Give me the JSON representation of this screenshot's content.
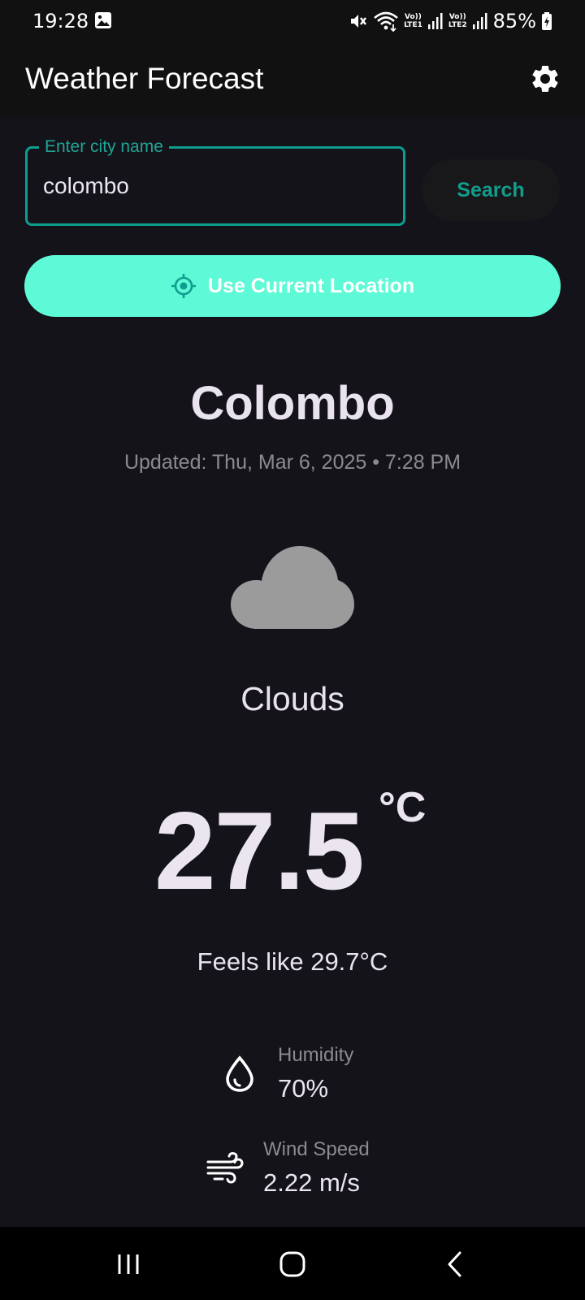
{
  "status_bar": {
    "time": "19:28",
    "battery": "85%",
    "sim1": [
      "Vo))",
      "LTE1"
    ],
    "sim2": [
      "Vo))",
      "LTE2"
    ]
  },
  "app_bar": {
    "title": "Weather Forecast"
  },
  "search": {
    "label": "Enter city name",
    "value": "colombo",
    "button": "Search"
  },
  "location_button": "Use Current Location",
  "weather": {
    "city": "Colombo",
    "updated": "Updated: Thu, Mar 6, 2025 • 7:28 PM",
    "condition": "Clouds",
    "temperature": "27.5",
    "unit": "°C",
    "feels_like": "Feels like 29.7°C"
  },
  "stats": {
    "humidity": {
      "label": "Humidity",
      "value": "70%"
    },
    "wind": {
      "label": "Wind Speed",
      "value": "2.22 m/s"
    }
  },
  "colors": {
    "accent": "#0f9d8e",
    "location_button": "#5ef9d6",
    "background": "#15131a"
  },
  "icons": {
    "settings": "gear-icon",
    "location": "crosshair-icon",
    "weather": "cloud-icon",
    "humidity": "droplet-icon",
    "wind": "wind-icon"
  }
}
